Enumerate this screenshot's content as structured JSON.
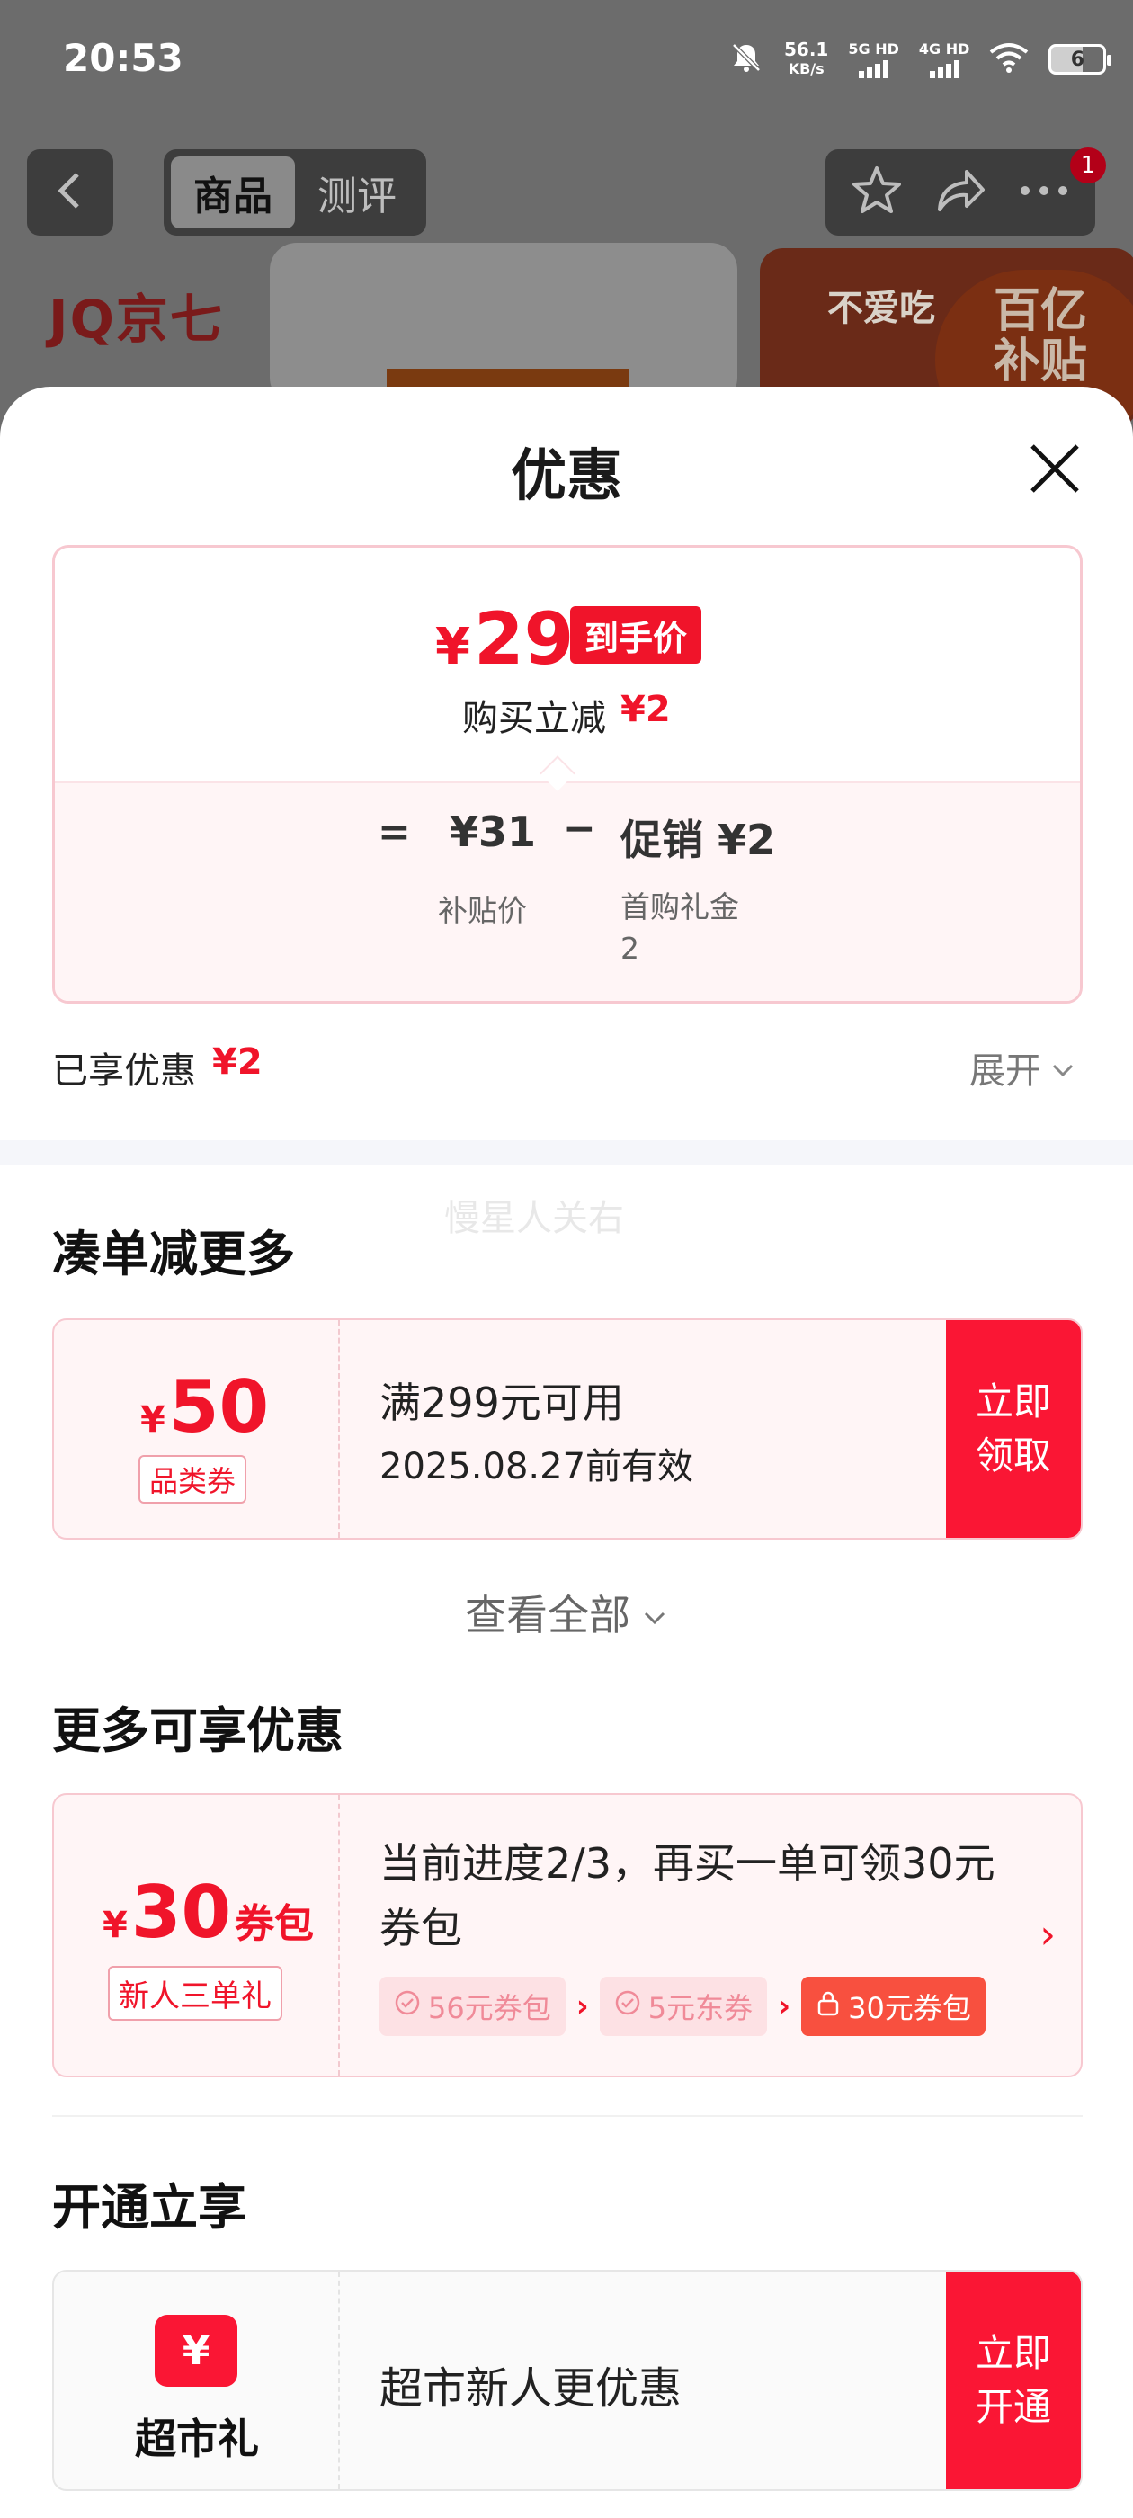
{
  "status_bar": {
    "time": "20:53",
    "speed_value": "56.1",
    "speed_unit": "KB/s",
    "sim1": "5G HD",
    "sim2": "4G HD",
    "battery": "6"
  },
  "nav": {
    "tabs": [
      {
        "label": "商品",
        "active": true
      },
      {
        "label": "测评",
        "active": false
      }
    ],
    "notification_count": "1"
  },
  "background": {
    "brand": "JQ京七",
    "ad_text": "不爱吃",
    "ad_badge_line1": "百亿",
    "ad_badge_line2": "补贴"
  },
  "sheet": {
    "title": "优惠",
    "summary": {
      "currency": "¥",
      "final_price": "29",
      "final_price_tag": "到手价",
      "reduce_label": "购买立减",
      "reduce_value": "¥2",
      "equals": "=",
      "subsidy_price": "¥31",
      "subsidy_caption": "补贴价",
      "minus": "−",
      "promo_value": "促销 ¥2",
      "promo_caption_line1": "首购礼金",
      "promo_caption_line2": "2"
    },
    "enjoyed_label": "已享优惠",
    "enjoyed_value": "¥2",
    "expand_label": "展开",
    "watermark": "慢星人关右",
    "section_combine": {
      "title": "凑单减更多",
      "coupon": {
        "currency": "¥",
        "amount": "50",
        "tag": "品类券",
        "condition": "满299元可用",
        "validity": "2025.08.27前有效",
        "button": "立即领取"
      },
      "view_all": "查看全部"
    },
    "section_more": {
      "title": "更多可享优惠",
      "pack": {
        "currency": "¥",
        "amount": "30",
        "unit": "券包",
        "tag": "新人三单礼",
        "description": "当前进度2/3，再买一单可领30元券包",
        "steps": [
          "56元券包",
          "5元东券",
          "30元券包"
        ]
      }
    },
    "section_open": {
      "title": "开通立享",
      "gift": {
        "icon_char": "¥",
        "label": "超市礼",
        "text": "超市新人更优惠",
        "button": "立即开通"
      }
    }
  },
  "colors": {
    "accent_red": "#f0142a",
    "button_red": "#fa1634",
    "coupon_bg": "#fff5f6"
  },
  "icons": [
    "mute-icon",
    "wifi-icon",
    "back-icon",
    "star-icon",
    "share-icon",
    "more-icon",
    "close-icon",
    "chevron-down-icon",
    "check-circle-icon",
    "lock-icon",
    "chevron-right-icon",
    "yuan-ticket-icon"
  ]
}
